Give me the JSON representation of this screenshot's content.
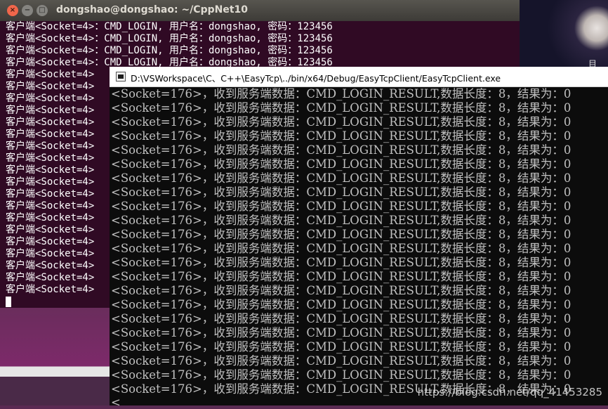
{
  "ubuntu_terminal": {
    "title": "dongshao@dongshao: ~/CppNet10",
    "buttons": {
      "close": "×",
      "minimize": "−",
      "maximize": "□"
    },
    "lines": [
      "客户端<Socket=4>：CMD_LOGIN, 用户名：dongshao, 密码：123456",
      "客户端<Socket=4>：CMD_LOGIN, 用户名：dongshao, 密码：123456",
      "客户端<Socket=4>：CMD_LOGIN, 用户名：dongshao, 密码：123456",
      "客户端<Socket=4>：CMD_LOGIN, 用户名：dongshao, 密码：123456",
      "客户端<Socket=4>",
      "客户端<Socket=4>",
      "客户端<Socket=4>",
      "客户端<Socket=4>",
      "客户端<Socket=4>",
      "客户端<Socket=4>",
      "客户端<Socket=4>",
      "客户端<Socket=4>",
      "客户端<Socket=4>",
      "客户端<Socket=4>",
      "客户端<Socket=4>",
      "客户端<Socket=4>",
      "客户端<Socket=4>",
      "客户端<Socket=4>",
      "客户端<Socket=4>",
      "客户端<Socket=4>",
      "客户端<Socket=4>",
      "客户端<Socket=4>",
      "客户端<Socket=4>"
    ]
  },
  "windows_console": {
    "title": "D:\\VSWorkspace\\C、C++\\EasyTcp\\../bin/x64/Debug/EasyTcpClient/EasyTcpClient.exe",
    "lines": [
      "<Socket=176>，收到服务端数据：CMD_LOGIN_RESULT,数据长度：8，结果为：0",
      "<Socket=176>，收到服务端数据：CMD_LOGIN_RESULT,数据长度：8，结果为：0",
      "<Socket=176>，收到服务端数据：CMD_LOGIN_RESULT,数据长度：8，结果为：0",
      "<Socket=176>，收到服务端数据：CMD_LOGIN_RESULT,数据长度：8，结果为：0",
      "<Socket=176>，收到服务端数据：CMD_LOGIN_RESULT,数据长度：8，结果为：0",
      "<Socket=176>，收到服务端数据：CMD_LOGIN_RESULT,数据长度：8，结果为：0",
      "<Socket=176>，收到服务端数据：CMD_LOGIN_RESULT,数据长度：8，结果为：0",
      "<Socket=176>，收到服务端数据：CMD_LOGIN_RESULT,数据长度：8，结果为：0",
      "<Socket=176>，收到服务端数据：CMD_LOGIN_RESULT,数据长度：8，结果为：0",
      "<Socket=176>，收到服务端数据：CMD_LOGIN_RESULT,数据长度：8，结果为：0",
      "<Socket=176>，收到服务端数据：CMD_LOGIN_RESULT,数据长度：8，结果为：0",
      "<Socket=176>，收到服务端数据：CMD_LOGIN_RESULT,数据长度：8，结果为：0",
      "<Socket=176>，收到服务端数据：CMD_LOGIN_RESULT,数据长度：8，结果为：0",
      "<Socket=176>，收到服务端数据：CMD_LOGIN_RESULT,数据长度：8，结果为：0",
      "<Socket=176>，收到服务端数据：CMD_LOGIN_RESULT,数据长度：8，结果为：0",
      "<Socket=176>，收到服务端数据：CMD_LOGIN_RESULT,数据长度：8，结果为：0",
      "<Socket=176>，收到服务端数据：CMD_LOGIN_RESULT,数据长度：8，结果为：0",
      "<Socket=176>，收到服务端数据：CMD_LOGIN_RESULT,数据长度：8，结果为：0",
      "<Socket=176>，收到服务端数据：CMD_LOGIN_RESULT,数据长度：8，结果为：0",
      "<Socket=176>，收到服务端数据：CMD_LOGIN_RESULT,数据长度：8，结果为：0",
      "<Socket=176>，收到服务端数据：CMD_LOGIN_RESULT,数据长度：8，结果为：0",
      "<Socket=176>，收到服务端数据：CMD_LOGIN_RESULT,数据长度：8，结果为：0"
    ],
    "partial_line": "<"
  },
  "watermark": "https://blog.csdn.net/qq_41453285",
  "desktop_icon": "目"
}
